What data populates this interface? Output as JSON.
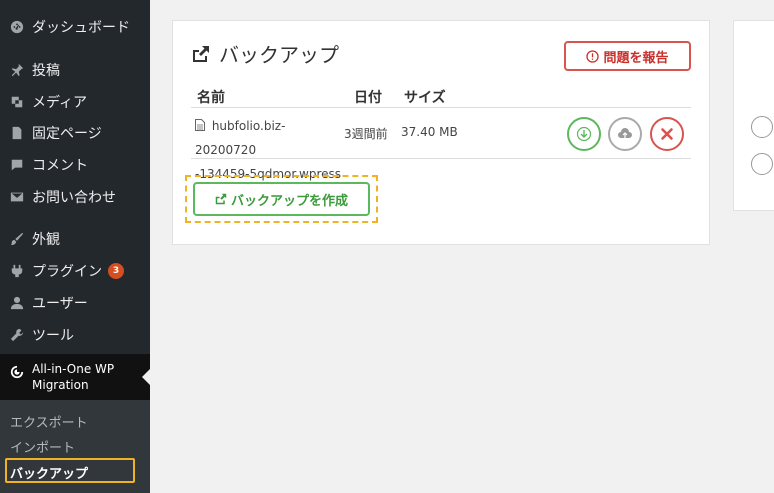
{
  "sidebar": {
    "items": [
      {
        "label": "ダッシュボード",
        "icon": "dashboard-icon"
      },
      {
        "label": "投稿",
        "icon": "pin-icon"
      },
      {
        "label": "メディア",
        "icon": "media-icon"
      },
      {
        "label": "固定ページ",
        "icon": "page-icon"
      },
      {
        "label": "コメント",
        "icon": "comment-icon"
      },
      {
        "label": "お問い合わせ",
        "icon": "mail-icon"
      },
      {
        "label": "外観",
        "icon": "brush-icon"
      },
      {
        "label": "プラグイン",
        "icon": "plugin-icon",
        "badge": "3"
      },
      {
        "label": "ユーザー",
        "icon": "user-icon"
      },
      {
        "label": "ツール",
        "icon": "wrench-icon"
      }
    ],
    "current": {
      "line1": "All-in-One WP",
      "line2": "Migration",
      "icon": "migration-icon"
    },
    "submenu": [
      {
        "label": "エクスポート"
      },
      {
        "label": "インポート"
      },
      {
        "label": "バックアップ"
      }
    ]
  },
  "panel": {
    "title": "バックアップ",
    "report_button": "問題を報告",
    "columns": {
      "name": "名前",
      "date": "日付",
      "size": "サイズ"
    },
    "backups": [
      {
        "name_line1": "hubfolio.biz-20200720",
        "name_line2": "-134459-5qdmor.wpress",
        "date": "3週間前",
        "size": "37.40 MB"
      }
    ],
    "create_button": "バックアップを作成"
  },
  "colors": {
    "sidebar_bg": "#23282d",
    "success": "#5cb85c",
    "danger": "#d9534f",
    "highlight": "#f0b323"
  }
}
